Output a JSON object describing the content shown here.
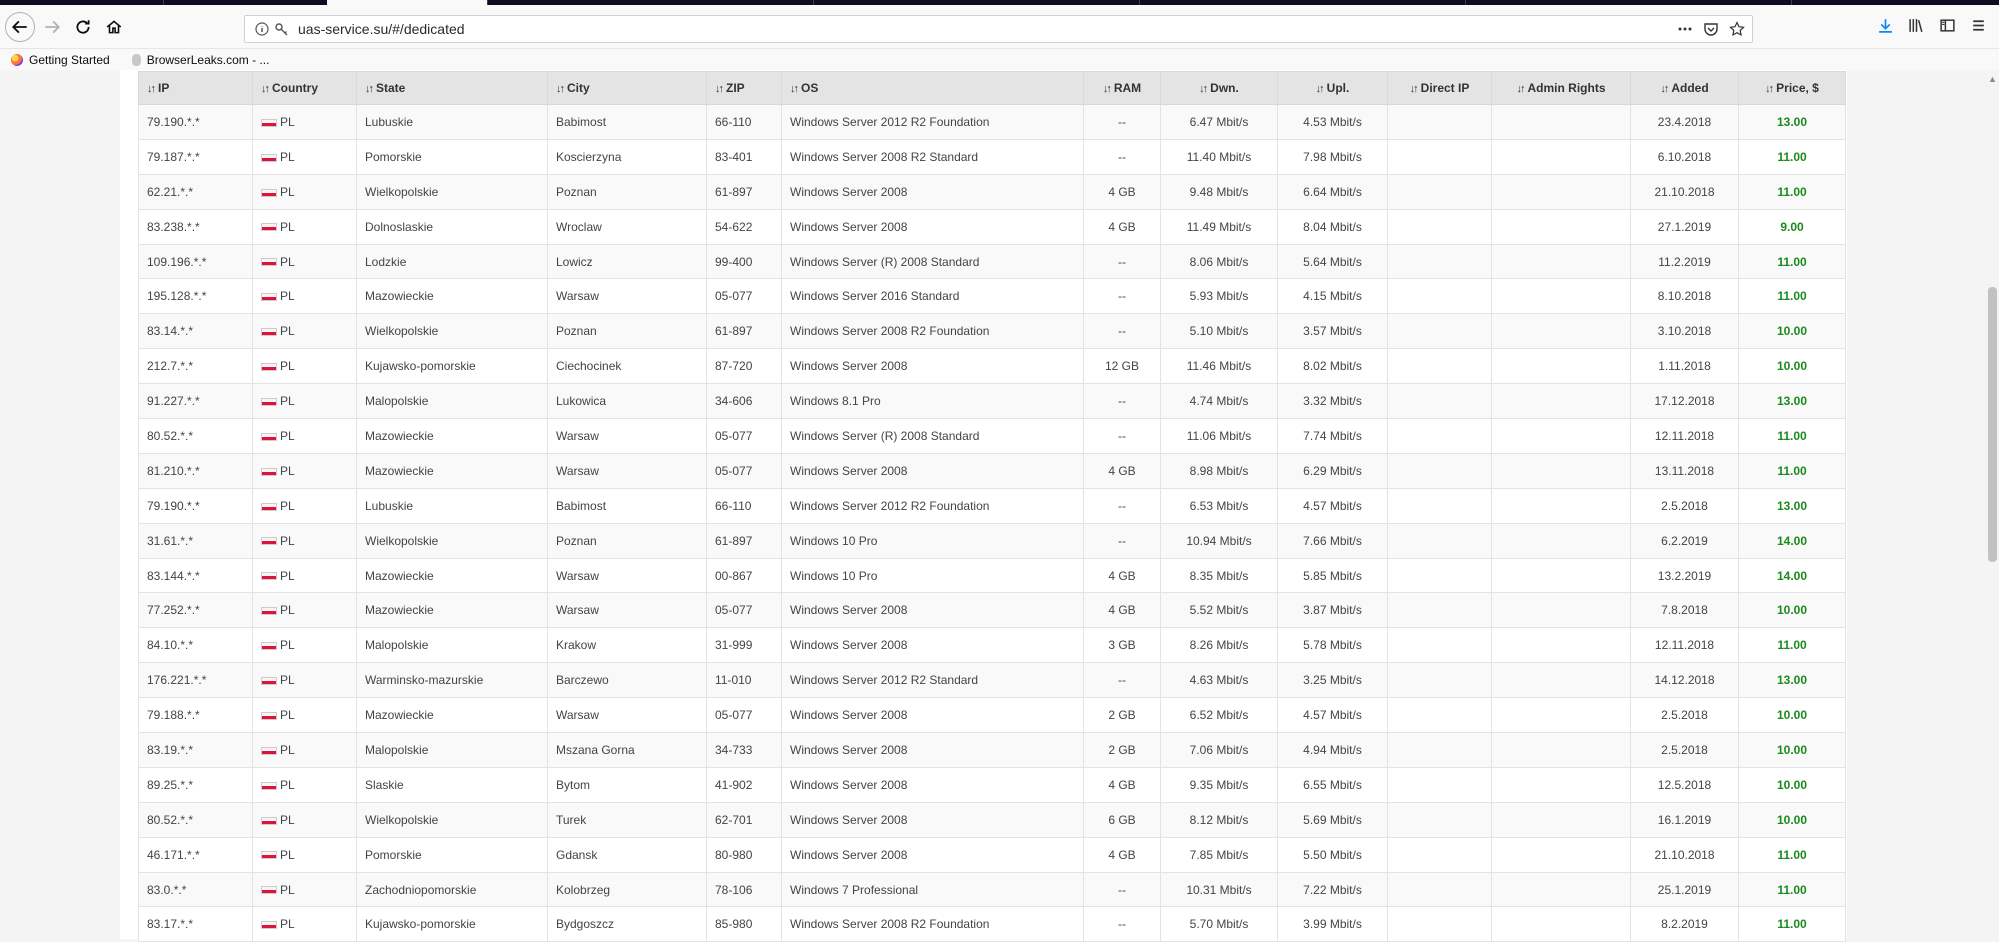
{
  "browser": {
    "url": "uas-service.su/#/dedicated",
    "bookmarks": [
      "Getting Started",
      "BrowserLeaks.com - ..."
    ]
  },
  "table": {
    "columns": [
      "IP",
      "Country",
      "State",
      "City",
      "ZIP",
      "OS",
      "RAM",
      "Dwn.",
      "Upl.",
      "Direct IP",
      "Admin Rights",
      "Added",
      "Price, $"
    ],
    "rows": [
      [
        "79.190.*.*",
        "PL",
        "Lubuskie",
        "Babimost",
        "66-110",
        "Windows Server 2012 R2 Foundation",
        "--",
        "6.47 Mbit/s",
        "4.53 Mbit/s",
        "",
        "",
        "23.4.2018",
        "13.00"
      ],
      [
        "79.187.*.*",
        "PL",
        "Pomorskie",
        "Koscierzyna",
        "83-401",
        "Windows Server 2008 R2 Standard",
        "--",
        "11.40 Mbit/s",
        "7.98 Mbit/s",
        "",
        "",
        "6.10.2018",
        "11.00"
      ],
      [
        "62.21.*.*",
        "PL",
        "Wielkopolskie",
        "Poznan",
        "61-897",
        "Windows Server 2008",
        "4 GB",
        "9.48 Mbit/s",
        "6.64 Mbit/s",
        "",
        "",
        "21.10.2018",
        "11.00"
      ],
      [
        "83.238.*.*",
        "PL",
        "Dolnoslaskie",
        "Wroclaw",
        "54-622",
        "Windows Server 2008",
        "4 GB",
        "11.49 Mbit/s",
        "8.04 Mbit/s",
        "",
        "",
        "27.1.2019",
        "9.00"
      ],
      [
        "109.196.*.*",
        "PL",
        "Lodzkie",
        "Lowicz",
        "99-400",
        "Windows Server (R) 2008 Standard",
        "--",
        "8.06 Mbit/s",
        "5.64 Mbit/s",
        "",
        "",
        "11.2.2019",
        "11.00"
      ],
      [
        "195.128.*.*",
        "PL",
        "Mazowieckie",
        "Warsaw",
        "05-077",
        "Windows Server 2016 Standard",
        "--",
        "5.93 Mbit/s",
        "4.15 Mbit/s",
        "",
        "",
        "8.10.2018",
        "11.00"
      ],
      [
        "83.14.*.*",
        "PL",
        "Wielkopolskie",
        "Poznan",
        "61-897",
        "Windows Server 2008 R2 Foundation",
        "--",
        "5.10 Mbit/s",
        "3.57 Mbit/s",
        "",
        "",
        "3.10.2018",
        "10.00"
      ],
      [
        "212.7.*.*",
        "PL",
        "Kujawsko-pomorskie",
        "Ciechocinek",
        "87-720",
        "Windows Server 2008",
        "12 GB",
        "11.46 Mbit/s",
        "8.02 Mbit/s",
        "",
        "",
        "1.11.2018",
        "10.00"
      ],
      [
        "91.227.*.*",
        "PL",
        "Malopolskie",
        "Lukowica",
        "34-606",
        "Windows 8.1 Pro",
        "--",
        "4.74 Mbit/s",
        "3.32 Mbit/s",
        "",
        "",
        "17.12.2018",
        "13.00"
      ],
      [
        "80.52.*.*",
        "PL",
        "Mazowieckie",
        "Warsaw",
        "05-077",
        "Windows Server (R) 2008 Standard",
        "--",
        "11.06 Mbit/s",
        "7.74 Mbit/s",
        "",
        "",
        "12.11.2018",
        "11.00"
      ],
      [
        "81.210.*.*",
        "PL",
        "Mazowieckie",
        "Warsaw",
        "05-077",
        "Windows Server 2008",
        "4 GB",
        "8.98 Mbit/s",
        "6.29 Mbit/s",
        "",
        "",
        "13.11.2018",
        "11.00"
      ],
      [
        "79.190.*.*",
        "PL",
        "Lubuskie",
        "Babimost",
        "66-110",
        "Windows Server 2012 R2 Foundation",
        "--",
        "6.53 Mbit/s",
        "4.57 Mbit/s",
        "",
        "",
        "2.5.2018",
        "13.00"
      ],
      [
        "31.61.*.*",
        "PL",
        "Wielkopolskie",
        "Poznan",
        "61-897",
        "Windows 10 Pro",
        "--",
        "10.94 Mbit/s",
        "7.66 Mbit/s",
        "",
        "",
        "6.2.2019",
        "14.00"
      ],
      [
        "83.144.*.*",
        "PL",
        "Mazowieckie",
        "Warsaw",
        "00-867",
        "Windows 10 Pro",
        "4 GB",
        "8.35 Mbit/s",
        "5.85 Mbit/s",
        "",
        "",
        "13.2.2019",
        "14.00"
      ],
      [
        "77.252.*.*",
        "PL",
        "Mazowieckie",
        "Warsaw",
        "05-077",
        "Windows Server 2008",
        "4 GB",
        "5.52 Mbit/s",
        "3.87 Mbit/s",
        "",
        "",
        "7.8.2018",
        "10.00"
      ],
      [
        "84.10.*.*",
        "PL",
        "Malopolskie",
        "Krakow",
        "31-999",
        "Windows Server 2008",
        "3 GB",
        "8.26 Mbit/s",
        "5.78 Mbit/s",
        "",
        "",
        "12.11.2018",
        "11.00"
      ],
      [
        "176.221.*.*",
        "PL",
        "Warminsko-mazurskie",
        "Barczewo",
        "11-010",
        "Windows Server 2012 R2 Standard",
        "--",
        "4.63 Mbit/s",
        "3.25 Mbit/s",
        "",
        "",
        "14.12.2018",
        "13.00"
      ],
      [
        "79.188.*.*",
        "PL",
        "Mazowieckie",
        "Warsaw",
        "05-077",
        "Windows Server 2008",
        "2 GB",
        "6.52 Mbit/s",
        "4.57 Mbit/s",
        "",
        "",
        "2.5.2018",
        "10.00"
      ],
      [
        "83.19.*.*",
        "PL",
        "Malopolskie",
        "Mszana Gorna",
        "34-733",
        "Windows Server 2008",
        "2 GB",
        "7.06 Mbit/s",
        "4.94 Mbit/s",
        "",
        "",
        "2.5.2018",
        "10.00"
      ],
      [
        "89.25.*.*",
        "PL",
        "Slaskie",
        "Bytom",
        "41-902",
        "Windows Server 2008",
        "4 GB",
        "9.35 Mbit/s",
        "6.55 Mbit/s",
        "",
        "",
        "12.5.2018",
        "10.00"
      ],
      [
        "80.52.*.*",
        "PL",
        "Wielkopolskie",
        "Turek",
        "62-701",
        "Windows Server 2008",
        "6 GB",
        "8.12 Mbit/s",
        "5.69 Mbit/s",
        "",
        "",
        "16.1.2019",
        "10.00"
      ],
      [
        "46.171.*.*",
        "PL",
        "Pomorskie",
        "Gdansk",
        "80-980",
        "Windows Server 2008",
        "4 GB",
        "7.85 Mbit/s",
        "5.50 Mbit/s",
        "",
        "",
        "21.10.2018",
        "11.00"
      ],
      [
        "83.0.*.*",
        "PL",
        "Zachodniopomorskie",
        "Kolobrzeg",
        "78-106",
        "Windows 7 Professional",
        "--",
        "10.31 Mbit/s",
        "7.22 Mbit/s",
        "",
        "",
        "25.1.2019",
        "11.00"
      ],
      [
        "83.17.*.*",
        "PL",
        "Kujawsko-pomorskie",
        "Bydgoszcz",
        "85-980",
        "Windows Server 2008 R2 Foundation",
        "--",
        "5.70 Mbit/s",
        "3.99 Mbit/s",
        "",
        "",
        "8.2.2019",
        "11.00"
      ]
    ]
  },
  "colors": {
    "price": "#1a8a1a",
    "header_bg": "#e4e4e4",
    "flag_red": "#dc143c"
  }
}
